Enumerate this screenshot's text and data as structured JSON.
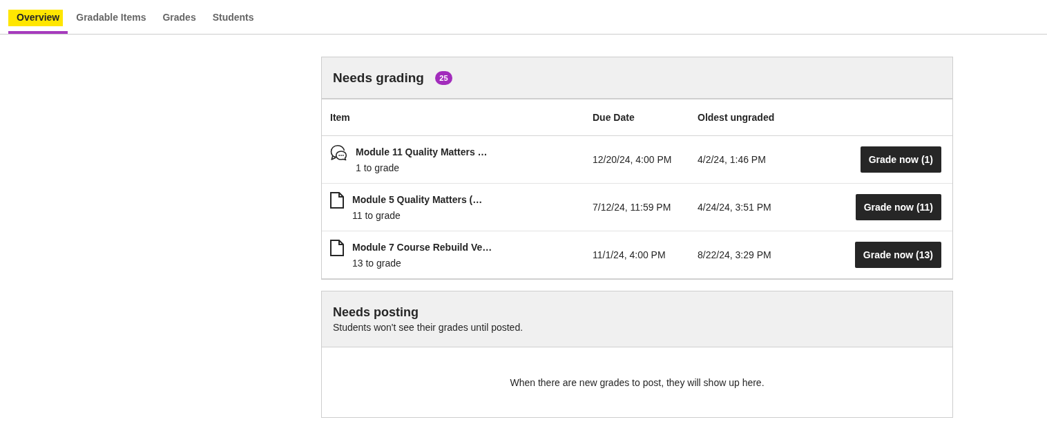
{
  "tabs": [
    {
      "label": "Overview",
      "selected": true
    },
    {
      "label": "Gradable Items",
      "selected": false
    },
    {
      "label": "Grades",
      "selected": false
    },
    {
      "label": "Students",
      "selected": false
    }
  ],
  "needs_grading": {
    "title": "Needs grading",
    "badge": "25",
    "columns": [
      "Item",
      "Due Date",
      "Oldest ungraded"
    ],
    "rows": [
      {
        "kind": "discussion",
        "title": "Module 11 Quality Matters …",
        "subtitle": "1 to grade",
        "due_date": "12/20/24, 4:00 PM",
        "oldest_ungraded": "4/2/24, 1:46 PM",
        "button": "Grade now (1)"
      },
      {
        "kind": "document",
        "title": "Module 5 Quality Matters (…",
        "subtitle": "11 to grade",
        "due_date": "7/12/24, 11:59 PM",
        "oldest_ungraded": "4/24/24, 3:51 PM",
        "button": "Grade now (11)"
      },
      {
        "kind": "document",
        "title": "Module 7 Course Rebuild Ve…",
        "subtitle": "13 to grade",
        "due_date": "11/1/24, 4:00 PM",
        "oldest_ungraded": "8/22/24, 3:29 PM",
        "button": "Grade now (13)"
      }
    ]
  },
  "needs_posting": {
    "title": "Needs posting",
    "subtitle": "Students won't see their grades until posted.",
    "empty_message": "When there are new grades to post, they will show up here."
  }
}
